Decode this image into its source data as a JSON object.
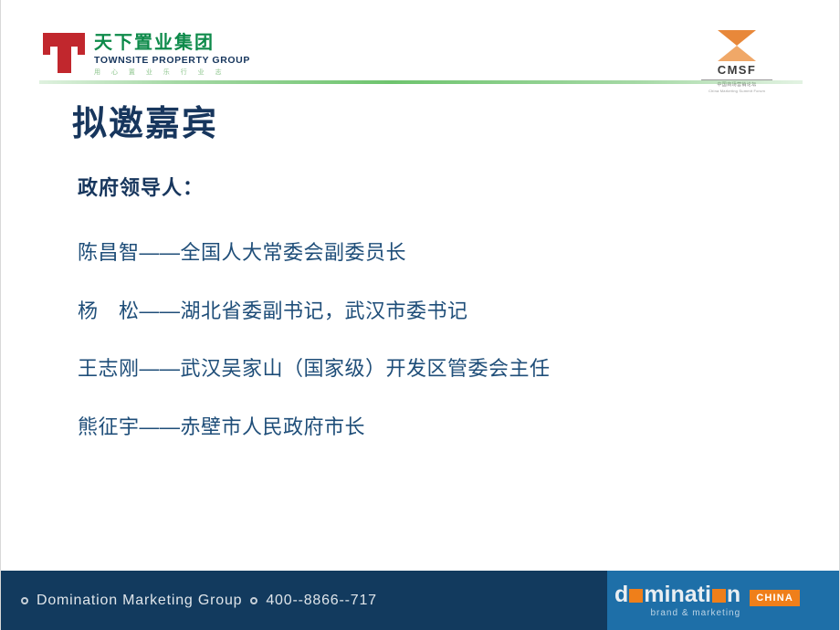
{
  "header": {
    "townsite_logo": {
      "mark": "red-t-mark",
      "chinese_name": "天下置业集团",
      "english_name": "TOWNSITE PROPERTY GROUP",
      "tagline": "用 心 置 业 乐 行 业 志"
    },
    "cmsf_logo": {
      "mark": "orange-hourglass-mark",
      "acronym": "CMSF",
      "chinese_subtitle": "中国商场营销论坛",
      "english_subtitle": "China Marketing Summit Forum"
    }
  },
  "main": {
    "title": "拟邀嘉宾",
    "section_heading": "政府领导人：",
    "entries": [
      "陈昌智——全国人大常委会副委员长",
      "杨　松——湖北省委副书记，武汉市委书记",
      "王志刚——武汉吴家山（国家级）开发区管委会主任",
      "熊征宇——赤壁市人民政府市长"
    ]
  },
  "footer": {
    "company": "Domination  Marketing  Group",
    "phone": "400--8866--717",
    "brand": {
      "word_part1": "d",
      "word_part2": "minati",
      "word_part3": "n",
      "tagline": "brand & marketing",
      "badge": "CHINA"
    }
  },
  "colors": {
    "title_navy": "#17365d",
    "body_blue": "#1f4e79",
    "logo_green": "#0d8a4a",
    "logo_red": "#c1272d",
    "accent_orange": "#ef7f1a",
    "footer_navy": "#123a5e",
    "footer_blue": "#1e6fa8",
    "rule_green": "#6ec46e"
  }
}
